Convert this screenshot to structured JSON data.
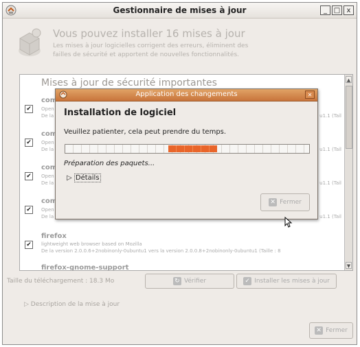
{
  "window": {
    "title": "Gestionnaire de mises à jour",
    "controls": [
      "_",
      "□",
      "x"
    ]
  },
  "header": {
    "title": "Vous pouvez installer 16 mises à jour",
    "description": "Les mises à jour logicielles corrigent des erreurs, éliminent des failles de sécurité et apportent de nouvelles fonctionnalités."
  },
  "list": {
    "heading": "Mises à jour de sécurité importantes",
    "items": [
      {
        "checked": "✔",
        "name": "com",
        "sub": "Open",
        "version": "De la",
        "tail": "u1.1 (Tail"
      },
      {
        "checked": "✔",
        "name": "com",
        "sub": "Open",
        "version": "De la",
        "tail": "u1.1 (Tail"
      },
      {
        "checked": "✔",
        "name": "com",
        "sub": "Open",
        "version": "De la",
        "tail": "u1.1 (Tail"
      },
      {
        "checked": "✔",
        "name": "com",
        "sub": "Open",
        "version": "De la",
        "tail": "u1.1 (Tail"
      },
      {
        "checked": "✔",
        "name": "firefox",
        "sub": "lightweight web browser based on Mozilla",
        "version": "De la version 2.0.0.6+2nobinonly-0ubuntu1 vers la version 2.0.0.8+2nobinonly-0ubuntu1 (Taille : 8"
      },
      {
        "checked": "",
        "name": "firefox-gnome-support",
        "sub": "",
        "version": ""
      }
    ]
  },
  "footer": {
    "download_size": "Taille du téléchargement : 18.3 Mo",
    "check_button": "Vérifier",
    "install_button": "Installer les mises à jour",
    "description_toggle": "Description de la mise à jour",
    "close_button": "Fermer"
  },
  "dialog": {
    "title": "Application des changements",
    "heading": "Installation de logiciel",
    "message": "Veuillez patienter, cela peut prendre du temps.",
    "status": "Préparation des paquets...",
    "details_label": "Détails",
    "close_button": "Fermer",
    "progress_fraction": 0.2
  },
  "icons": {
    "app": "update-manager-icon",
    "header": "package-update-icon",
    "dialog": "package-icon",
    "check": "refresh-icon",
    "install": "check-icon",
    "close": "close-icon"
  },
  "colors": {
    "accent": "#e9652a",
    "dialog_title": "#c8743b",
    "window_bg": "#efebe7"
  }
}
